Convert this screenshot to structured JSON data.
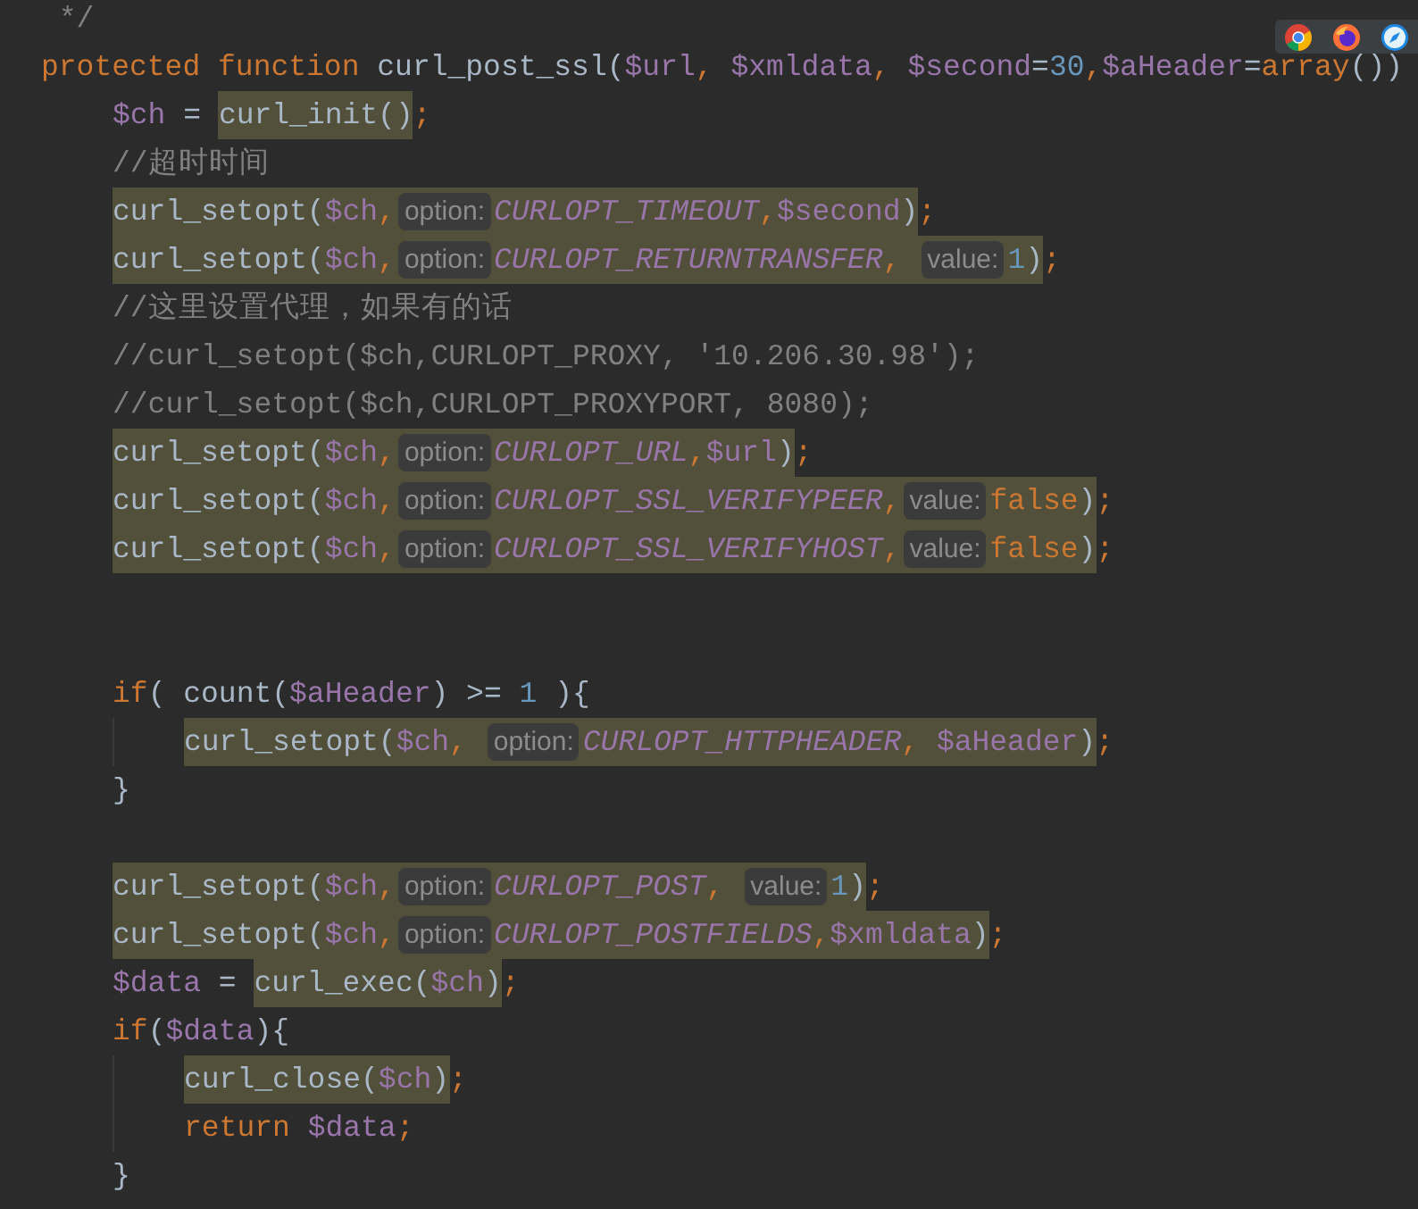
{
  "editor": {
    "lines": [
      {
        "segments": [
          {
            "highlighted": false,
            "tokens": [
              {
                "kind": "comment",
                "text": " */"
              }
            ]
          }
        ]
      },
      {
        "segments": [
          {
            "highlighted": false,
            "tokens": [
              {
                "kind": "keyword",
                "text": "protected function "
              },
              {
                "kind": "plain",
                "text": "curl_post_ssl("
              },
              {
                "kind": "variable",
                "text": "$url"
              },
              {
                "kind": "keyword",
                "text": ", "
              },
              {
                "kind": "variable",
                "text": "$xmldata"
              },
              {
                "kind": "keyword",
                "text": ", "
              },
              {
                "kind": "variable",
                "text": "$second"
              },
              {
                "kind": "plain",
                "text": "="
              },
              {
                "kind": "number",
                "text": "30"
              },
              {
                "kind": "keyword",
                "text": ","
              },
              {
                "kind": "variable",
                "text": "$aHeader"
              },
              {
                "kind": "plain",
                "text": "="
              },
              {
                "kind": "keyword",
                "text": "array"
              },
              {
                "kind": "plain",
                "text": "())"
              }
            ]
          }
        ],
        "children": [
          {
            "segments": [
              {
                "highlighted": false,
                "tokens": [
                  {
                    "kind": "variable",
                    "text": "$ch"
                  },
                  {
                    "kind": "plain",
                    "text": " = "
                  }
                ]
              },
              {
                "highlighted": true,
                "tokens": [
                  {
                    "kind": "plain",
                    "text": "curl_init()"
                  }
                ]
              },
              {
                "highlighted": false,
                "tokens": [
                  {
                    "kind": "keyword",
                    "text": ";"
                  }
                ]
              }
            ]
          },
          {
            "segments": [
              {
                "highlighted": false,
                "tokens": [
                  {
                    "kind": "comment",
                    "text": "//超时时间"
                  }
                ]
              }
            ]
          },
          {
            "segments": [
              {
                "highlighted": true,
                "tokens": [
                  {
                    "kind": "plain",
                    "text": "curl_setopt("
                  },
                  {
                    "kind": "variable",
                    "text": "$ch"
                  },
                  {
                    "kind": "keyword",
                    "text": ","
                  },
                  {
                    "kind": "hint",
                    "text": "option:"
                  },
                  {
                    "kind": "constant",
                    "text": "CURLOPT_TIMEOUT"
                  },
                  {
                    "kind": "keyword",
                    "text": ","
                  },
                  {
                    "kind": "variable",
                    "text": "$second"
                  },
                  {
                    "kind": "plain",
                    "text": ")"
                  }
                ]
              },
              {
                "highlighted": false,
                "tokens": [
                  {
                    "kind": "keyword",
                    "text": ";"
                  }
                ]
              }
            ]
          },
          {
            "segments": [
              {
                "highlighted": true,
                "tokens": [
                  {
                    "kind": "plain",
                    "text": "curl_setopt("
                  },
                  {
                    "kind": "variable",
                    "text": "$ch"
                  },
                  {
                    "kind": "keyword",
                    "text": ","
                  },
                  {
                    "kind": "hint",
                    "text": "option:"
                  },
                  {
                    "kind": "constant",
                    "text": "CURLOPT_RETURNTRANSFER"
                  },
                  {
                    "kind": "keyword",
                    "text": ", "
                  },
                  {
                    "kind": "hint",
                    "text": "value:"
                  },
                  {
                    "kind": "number",
                    "text": "1"
                  },
                  {
                    "kind": "plain",
                    "text": ")"
                  }
                ]
              },
              {
                "highlighted": false,
                "tokens": [
                  {
                    "kind": "keyword",
                    "text": ";"
                  }
                ]
              }
            ]
          },
          {
            "segments": [
              {
                "highlighted": false,
                "tokens": [
                  {
                    "kind": "comment",
                    "text": "//这里设置代理，如果有的话"
                  }
                ]
              }
            ]
          },
          {
            "segments": [
              {
                "highlighted": false,
                "tokens": [
                  {
                    "kind": "comment",
                    "text": "//curl_setopt($ch,CURLOPT_PROXY, '10.206.30.98');"
                  }
                ]
              }
            ]
          },
          {
            "segments": [
              {
                "highlighted": false,
                "tokens": [
                  {
                    "kind": "comment",
                    "text": "//curl_setopt($ch,CURLOPT_PROXYPORT, 8080);"
                  }
                ]
              }
            ]
          },
          {
            "segments": [
              {
                "highlighted": true,
                "tokens": [
                  {
                    "kind": "plain",
                    "text": "curl_setopt("
                  },
                  {
                    "kind": "variable",
                    "text": "$ch"
                  },
                  {
                    "kind": "keyword",
                    "text": ","
                  },
                  {
                    "kind": "hint",
                    "text": "option:"
                  },
                  {
                    "kind": "constant",
                    "text": "CURLOPT_URL"
                  },
                  {
                    "kind": "keyword",
                    "text": ","
                  },
                  {
                    "kind": "variable",
                    "text": "$url"
                  },
                  {
                    "kind": "plain",
                    "text": ")"
                  }
                ]
              },
              {
                "highlighted": false,
                "tokens": [
                  {
                    "kind": "keyword",
                    "text": ";"
                  }
                ]
              }
            ]
          },
          {
            "segments": [
              {
                "highlighted": true,
                "tokens": [
                  {
                    "kind": "plain",
                    "text": "curl_setopt("
                  },
                  {
                    "kind": "variable",
                    "text": "$ch"
                  },
                  {
                    "kind": "keyword",
                    "text": ","
                  },
                  {
                    "kind": "hint",
                    "text": "option:"
                  },
                  {
                    "kind": "constant",
                    "text": "CURLOPT_SSL_VERIFYPEER"
                  },
                  {
                    "kind": "keyword",
                    "text": ","
                  },
                  {
                    "kind": "hint",
                    "text": "value:"
                  },
                  {
                    "kind": "keyword",
                    "text": "false"
                  },
                  {
                    "kind": "plain",
                    "text": ")"
                  }
                ]
              },
              {
                "highlighted": false,
                "tokens": [
                  {
                    "kind": "keyword",
                    "text": ";"
                  }
                ]
              }
            ]
          },
          {
            "segments": [
              {
                "highlighted": true,
                "tokens": [
                  {
                    "kind": "plain",
                    "text": "curl_setopt("
                  },
                  {
                    "kind": "variable",
                    "text": "$ch"
                  },
                  {
                    "kind": "keyword",
                    "text": ","
                  },
                  {
                    "kind": "hint",
                    "text": "option:"
                  },
                  {
                    "kind": "constant",
                    "text": "CURLOPT_SSL_VERIFYHOST"
                  },
                  {
                    "kind": "keyword",
                    "text": ","
                  },
                  {
                    "kind": "hint",
                    "text": "value:"
                  },
                  {
                    "kind": "keyword",
                    "text": "false"
                  },
                  {
                    "kind": "plain",
                    "text": ")"
                  }
                ]
              },
              {
                "highlighted": false,
                "tokens": [
                  {
                    "kind": "keyword",
                    "text": ";"
                  }
                ]
              }
            ]
          },
          {
            "kind": "blank"
          },
          {
            "kind": "blank"
          },
          {
            "segments": [
              {
                "highlighted": false,
                "tokens": [
                  {
                    "kind": "keyword",
                    "text": "if"
                  },
                  {
                    "kind": "plain",
                    "text": "( count("
                  },
                  {
                    "kind": "variable",
                    "text": "$aHeader"
                  },
                  {
                    "kind": "plain",
                    "text": ") >= "
                  },
                  {
                    "kind": "number",
                    "text": "1"
                  },
                  {
                    "kind": "plain",
                    "text": " ){"
                  }
                ]
              }
            ],
            "children": [
              {
                "segments": [
                  {
                    "highlighted": true,
                    "tokens": [
                      {
                        "kind": "plain",
                        "text": "curl_setopt("
                      },
                      {
                        "kind": "variable",
                        "text": "$ch"
                      },
                      {
                        "kind": "keyword",
                        "text": ", "
                      },
                      {
                        "kind": "hint",
                        "text": "option:"
                      },
                      {
                        "kind": "constant",
                        "text": "CURLOPT_HTTPHEADER"
                      },
                      {
                        "kind": "keyword",
                        "text": ", "
                      },
                      {
                        "kind": "variable",
                        "text": "$aHeader"
                      },
                      {
                        "kind": "plain",
                        "text": ")"
                      }
                    ]
                  },
                  {
                    "highlighted": false,
                    "tokens": [
                      {
                        "kind": "keyword",
                        "text": ";"
                      }
                    ]
                  }
                ]
              }
            ]
          },
          {
            "segments": [
              {
                "highlighted": false,
                "tokens": [
                  {
                    "kind": "plain",
                    "text": "}"
                  }
                ]
              }
            ]
          },
          {
            "kind": "blank"
          },
          {
            "segments": [
              {
                "highlighted": true,
                "tokens": [
                  {
                    "kind": "plain",
                    "text": "curl_setopt("
                  },
                  {
                    "kind": "variable",
                    "text": "$ch"
                  },
                  {
                    "kind": "keyword",
                    "text": ","
                  },
                  {
                    "kind": "hint",
                    "text": "option:"
                  },
                  {
                    "kind": "constant",
                    "text": "CURLOPT_POST"
                  },
                  {
                    "kind": "keyword",
                    "text": ", "
                  },
                  {
                    "kind": "hint",
                    "text": "value:"
                  },
                  {
                    "kind": "number",
                    "text": "1"
                  },
                  {
                    "kind": "plain",
                    "text": ")"
                  }
                ]
              },
              {
                "highlighted": false,
                "tokens": [
                  {
                    "kind": "keyword",
                    "text": ";"
                  }
                ]
              }
            ]
          },
          {
            "segments": [
              {
                "highlighted": true,
                "tokens": [
                  {
                    "kind": "plain",
                    "text": "curl_setopt("
                  },
                  {
                    "kind": "variable",
                    "text": "$ch"
                  },
                  {
                    "kind": "keyword",
                    "text": ","
                  },
                  {
                    "kind": "hint",
                    "text": "option:"
                  },
                  {
                    "kind": "constant",
                    "text": "CURLOPT_POSTFIELDS"
                  },
                  {
                    "kind": "keyword",
                    "text": ","
                  },
                  {
                    "kind": "variable",
                    "text": "$xmldata"
                  },
                  {
                    "kind": "plain",
                    "text": ")"
                  }
                ]
              },
              {
                "highlighted": false,
                "tokens": [
                  {
                    "kind": "keyword",
                    "text": ";"
                  }
                ]
              }
            ]
          },
          {
            "segments": [
              {
                "highlighted": false,
                "tokens": [
                  {
                    "kind": "variable",
                    "text": "$data"
                  },
                  {
                    "kind": "plain",
                    "text": " = "
                  }
                ]
              },
              {
                "highlighted": true,
                "tokens": [
                  {
                    "kind": "plain",
                    "text": "curl_exec("
                  },
                  {
                    "kind": "variable",
                    "text": "$ch"
                  },
                  {
                    "kind": "plain",
                    "text": ")"
                  }
                ]
              },
              {
                "highlighted": false,
                "tokens": [
                  {
                    "kind": "keyword",
                    "text": ";"
                  }
                ]
              }
            ]
          },
          {
            "segments": [
              {
                "highlighted": false,
                "tokens": [
                  {
                    "kind": "keyword",
                    "text": "if"
                  },
                  {
                    "kind": "plain",
                    "text": "("
                  },
                  {
                    "kind": "variable",
                    "text": "$data"
                  },
                  {
                    "kind": "plain",
                    "text": "){"
                  }
                ]
              }
            ],
            "children": [
              {
                "segments": [
                  {
                    "highlighted": true,
                    "tokens": [
                      {
                        "kind": "plain",
                        "text": "curl_close("
                      },
                      {
                        "kind": "variable",
                        "text": "$ch"
                      },
                      {
                        "kind": "plain",
                        "text": ")"
                      }
                    ]
                  },
                  {
                    "highlighted": false,
                    "tokens": [
                      {
                        "kind": "keyword",
                        "text": ";"
                      }
                    ]
                  }
                ]
              },
              {
                "segments": [
                  {
                    "highlighted": false,
                    "tokens": [
                      {
                        "kind": "keyword",
                        "text": "return "
                      },
                      {
                        "kind": "variable",
                        "text": "$data"
                      },
                      {
                        "kind": "keyword",
                        "text": ";"
                      }
                    ]
                  }
                ]
              }
            ]
          },
          {
            "segments": [
              {
                "highlighted": false,
                "tokens": [
                  {
                    "kind": "plain",
                    "text": "}"
                  }
                ]
              }
            ]
          }
        ]
      }
    ]
  },
  "browser_bar": {
    "icons": [
      {
        "kind": "chrome"
      },
      {
        "kind": "firefox"
      },
      {
        "kind": "safari"
      }
    ]
  }
}
